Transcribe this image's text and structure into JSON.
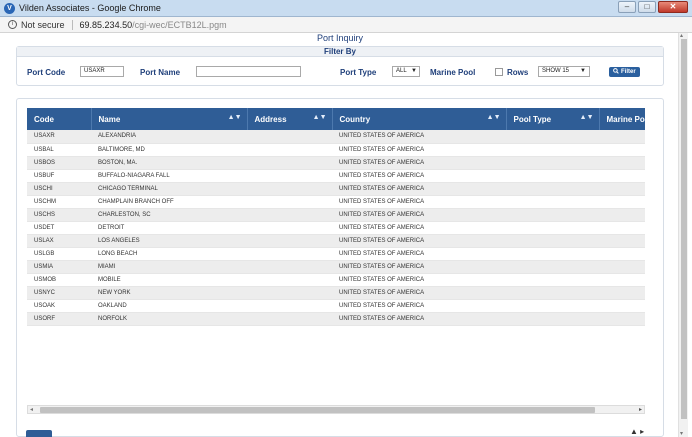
{
  "window": {
    "logo": "V",
    "title": "Vilden Associates - Google Chrome",
    "controls": {
      "minimize": "–",
      "maximize": "□",
      "close": "✕"
    }
  },
  "addressbar": {
    "info_glyph": "i",
    "security_label": "Not secure",
    "url_host": "69.85.234.50",
    "url_path": "/cgi-wec/ECTB12L.pgm"
  },
  "page": {
    "title": "Port Inquiry"
  },
  "filter": {
    "heading": "Filter By",
    "port_code_label": "Port Code",
    "port_code_value": "USAXR",
    "port_name_label": "Port Name",
    "port_name_value": "",
    "port_type_label": "Port Type",
    "port_type_value": "ALL",
    "marine_pool_label": "Marine Pool",
    "rows_label": "Rows",
    "rows_value": "SHOW 15",
    "filter_button": "Filter",
    "filter_icon": "search-icon"
  },
  "table": {
    "columns": [
      "Code",
      "Name",
      "Address",
      "Country",
      "Pool Type",
      "Marine Pool"
    ],
    "rows": [
      {
        "code": "USAXR",
        "name": "ALEXANDRIA",
        "address": "",
        "country": "UNITED STATES OF AMERICA",
        "pool_type": "",
        "marine_pool": ""
      },
      {
        "code": "USBAL",
        "name": "BALTIMORE, MD",
        "address": "",
        "country": "UNITED STATES OF AMERICA",
        "pool_type": "",
        "marine_pool": ""
      },
      {
        "code": "USBOS",
        "name": "BOSTON, MA.",
        "address": "",
        "country": "UNITED STATES OF AMERICA",
        "pool_type": "",
        "marine_pool": ""
      },
      {
        "code": "USBUF",
        "name": "BUFFALO-NIAGARA FALL",
        "address": "",
        "country": "UNITED STATES OF AMERICA",
        "pool_type": "",
        "marine_pool": ""
      },
      {
        "code": "USCHI",
        "name": "CHICAGO TERMINAL",
        "address": "",
        "country": "UNITED STATES OF AMERICA",
        "pool_type": "",
        "marine_pool": ""
      },
      {
        "code": "USCHM",
        "name": "CHAMPLAIN BRANCH OFF",
        "address": "",
        "country": "UNITED STATES OF AMERICA",
        "pool_type": "",
        "marine_pool": ""
      },
      {
        "code": "USCHS",
        "name": "CHARLESTON, SC",
        "address": "",
        "country": "UNITED STATES OF AMERICA",
        "pool_type": "",
        "marine_pool": ""
      },
      {
        "code": "USDET",
        "name": "DETROIT",
        "address": "",
        "country": "UNITED STATES OF AMERICA",
        "pool_type": "",
        "marine_pool": ""
      },
      {
        "code": "USLAX",
        "name": "LOS ANGELES",
        "address": "",
        "country": "UNITED STATES OF AMERICA",
        "pool_type": "",
        "marine_pool": ""
      },
      {
        "code": "USLGB",
        "name": "LONG BEACH",
        "address": "",
        "country": "UNITED STATES OF AMERICA",
        "pool_type": "",
        "marine_pool": ""
      },
      {
        "code": "USMIA",
        "name": "MIAMI",
        "address": "",
        "country": "UNITED STATES OF AMERICA",
        "pool_type": "",
        "marine_pool": ""
      },
      {
        "code": "USMOB",
        "name": "MOBILE",
        "address": "",
        "country": "UNITED STATES OF AMERICA",
        "pool_type": "",
        "marine_pool": ""
      },
      {
        "code": "USNYC",
        "name": "NEW YORK",
        "address": "",
        "country": "UNITED STATES OF AMERICA",
        "pool_type": "",
        "marine_pool": ""
      },
      {
        "code": "USOAK",
        "name": "OAKLAND",
        "address": "",
        "country": "UNITED STATES OF AMERICA",
        "pool_type": "",
        "marine_pool": ""
      },
      {
        "code": "USORF",
        "name": "NORFOLK",
        "address": "",
        "country": "UNITED STATES OF AMERICA",
        "pool_type": "",
        "marine_pool": ""
      }
    ]
  },
  "colors": {
    "header_bg": "#2f5d96",
    "accent_text": "#1f3f7a",
    "filter_button": "#2a5f9e",
    "row_stripe": "#ededed"
  }
}
